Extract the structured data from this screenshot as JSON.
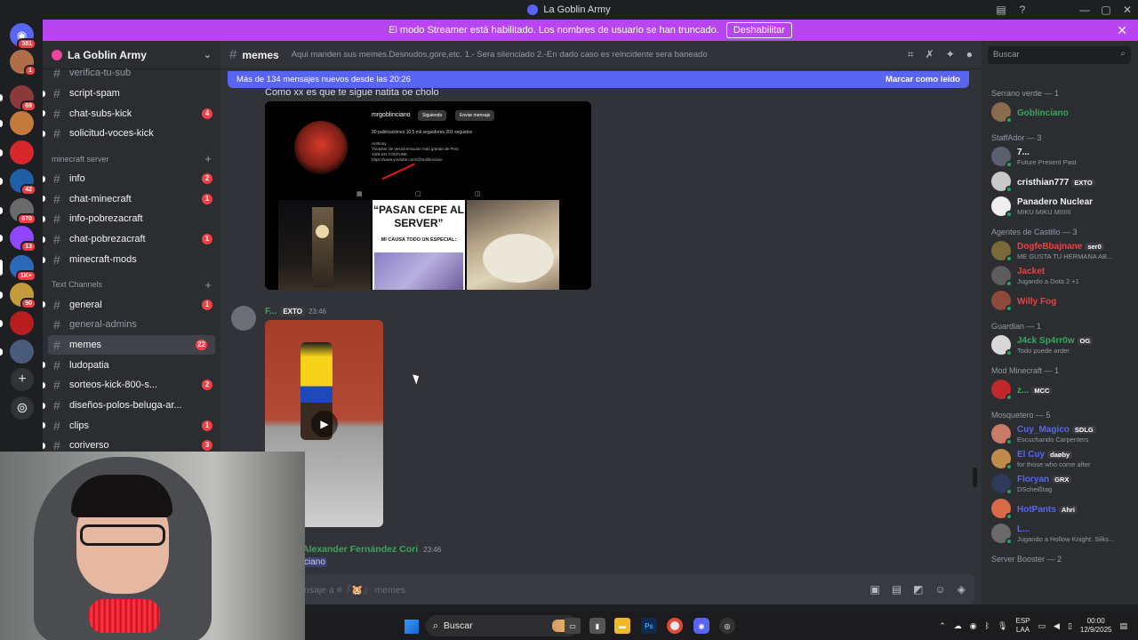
{
  "window": {
    "title": "La Goblin Army"
  },
  "banner": {
    "text": "El modo Streamer está habilitado. Los nombres de usuario se han truncado.",
    "button": "Deshabilitar"
  },
  "rail": {
    "badges": [
      "381",
      "1",
      "69",
      "42",
      "670",
      "13",
      "1K+",
      "90"
    ]
  },
  "server": {
    "name": "La Goblin Army"
  },
  "sidebar": {
    "top_channels": [
      {
        "name": "verifica-tu-sub",
        "badge": ""
      },
      {
        "name": "script-spam",
        "badge": ""
      },
      {
        "name": "chat-subs-kick",
        "badge": "4"
      },
      {
        "name": "solicitud-voces-kick",
        "badge": ""
      }
    ],
    "cat_minecraft": "minecraft server",
    "minecraft_channels": [
      {
        "name": "info",
        "badge": "2"
      },
      {
        "name": "chat-minecraft",
        "badge": "1"
      },
      {
        "name": "info-pobrezacraft",
        "badge": ""
      },
      {
        "name": "chat-pobrezacraft",
        "badge": "1"
      },
      {
        "name": "minecraft-mods",
        "badge": ""
      }
    ],
    "cat_text": "Text Channels",
    "text_channels": [
      {
        "name": "general",
        "badge": "1"
      },
      {
        "name": "general-admins",
        "badge": ""
      },
      {
        "name": "memes",
        "badge": "22"
      },
      {
        "name": "ludopatia",
        "badge": ""
      },
      {
        "name": "sorteos-kick-800-s...",
        "badge": "2"
      },
      {
        "name": "diseños-polos-beluga-ar...",
        "badge": ""
      },
      {
        "name": "clips",
        "badge": "1"
      },
      {
        "name": "coriverso",
        "badge": "3"
      }
    ]
  },
  "chat": {
    "channel": "memes",
    "topic": "Aqui manden sus memes.Desnudos,gore,etc. 1.- Sera silenciado 2.-En dado caso es reincidente sera baneado",
    "new_messages": "Más de 134 mensajes nuevos desde las 20:26",
    "mark_read": "Marcar como leído",
    "msg1_text": "Como xx es que te sigue natita oe cholo",
    "embed": {
      "username": "mrgoblinciano",
      "follow_btn": "Siguiendo",
      "send_btn": "Enviar mensaje",
      "stats": "90 publicaciones   10,5 mil seguidores   201 seguidos",
      "bio1": "Anthony",
      "bio2": "Youtuber de desinformación más grande de Perú",
      "bio3": "100k EN YOUTUBE",
      "bio4": "https://www.youtube.com/@Goblinciano",
      "post_title": "“PASAN CEPE AL SERVER”",
      "post_sub": "MI CAUSA TODO UN ESPECIAL:"
    },
    "msg2_user": "F...",
    "msg2_tag": "EXTO",
    "msg2_time": "23:46",
    "msg3_user": "Alexander Fernández Cori",
    "msg3_time": "23:46",
    "msg3_text": "ciano",
    "composer_placeholder": "nsaje a #『🐹』 memes"
  },
  "members": {
    "search_placeholder": "Buscar",
    "groups": [
      {
        "title": "Serrano verde — 1",
        "items": [
          {
            "name": "Goblinciano",
            "color": "#3ba55d",
            "tag": "",
            "status": "",
            "av": "#8a6b4e"
          }
        ]
      },
      {
        "title": "StaffAdor — 3",
        "items": [
          {
            "name": "7...",
            "color": "#f2f3f5",
            "tag": "",
            "status": "Future Present Past",
            "av": "#5a6070"
          },
          {
            "name": "cristhian777",
            "color": "#f2f3f5",
            "tag": "EXTO",
            "status": "",
            "av": "#c9c9c9"
          },
          {
            "name": "Panadero Nuclear",
            "color": "#f2f3f5",
            "tag": "",
            "status": "MIKU MIKU MIIIIII",
            "av": "#eeeeee"
          }
        ]
      },
      {
        "title": "Agentes de Castillo — 3",
        "items": [
          {
            "name": "DogfeBbajnane",
            "color": "#f23f43",
            "tag": "ser0",
            "status": "ME GUSTA TU HERMANA AB...",
            "av": "#7a6a3a"
          },
          {
            "name": "Jacket",
            "color": "#f23f43",
            "tag": "",
            "status": "Jugando a Dota 2 +1",
            "av": "#5c5c5c"
          },
          {
            "name": "Willy Fog",
            "color": "#f23f43",
            "tag": "",
            "status": "",
            "av": "#8b4a3a"
          }
        ]
      },
      {
        "title": "Guardian — 1",
        "items": [
          {
            "name": "J4ck Sp4rr0w",
            "color": "#3ba55d",
            "tag": "OG",
            "status": "Todo puede arder",
            "av": "#d8d8d8"
          }
        ]
      },
      {
        "title": "Mod Minecraft — 1",
        "items": [
          {
            "name": "z...",
            "color": "#3ba55d",
            "tag": "MCC",
            "status": "",
            "av": "#c0282c"
          }
        ]
      },
      {
        "title": "Mosquetero — 5",
        "items": [
          {
            "name": "Cuy_Magico",
            "color": "#5865f2",
            "tag": "SDLG",
            "status": "Escuchando Carpenters",
            "av": "#c97b6a"
          },
          {
            "name": "El Cuy",
            "color": "#5865f2",
            "tag": "daøby",
            "status": "for those who come after",
            "av": "#c08a4a"
          },
          {
            "name": "Floryan",
            "color": "#5865f2",
            "tag": "GRX",
            "status": "DScheißtag",
            "av": "#2f3a5a"
          },
          {
            "name": "HotPants",
            "color": "#5865f2",
            "tag": "Ahri",
            "status": "",
            "av": "#d86a4a"
          },
          {
            "name": "L...",
            "color": "#5865f2",
            "tag": "",
            "status": "Jugando a Hollow Knight: Silks...",
            "av": "#6a6a6a"
          }
        ]
      },
      {
        "title": "Server Booster — 2",
        "items": []
      }
    ]
  },
  "taskbar": {
    "search": "Buscar",
    "lang1": "ESP",
    "lang2": "LAA",
    "time": "00:00",
    "date": "12/9/2025"
  }
}
